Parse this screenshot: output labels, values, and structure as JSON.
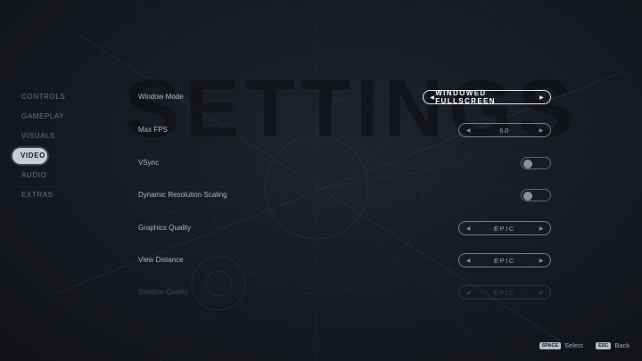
{
  "watermark": "SETTINGS",
  "nav": {
    "items": [
      {
        "label": "CONTROLS",
        "active": false
      },
      {
        "label": "GAMEPLAY",
        "active": false
      },
      {
        "label": "VISUALS",
        "active": false
      },
      {
        "label": "VIDEO",
        "active": true
      },
      {
        "label": "AUDIO",
        "active": false
      },
      {
        "label": "EXTRAS",
        "active": false
      }
    ]
  },
  "settings": {
    "window_mode": {
      "label": "Window Mode",
      "value": "WINDOWED FULLSCREEN"
    },
    "max_fps": {
      "label": "Max FPS",
      "value": "60"
    },
    "vsync": {
      "label": "VSync",
      "on": false
    },
    "dynamic_resolution": {
      "label": "Dynamic Resolution Scaling",
      "on": false
    },
    "graphics_quality": {
      "label": "Graphics Quality",
      "value": "EPIC"
    },
    "view_distance": {
      "label": "View Distance",
      "value": "EPIC"
    },
    "shadow_quality": {
      "label": "Shadow Quality",
      "value": "EPIC"
    }
  },
  "footer": {
    "select_key": "SPACE",
    "select_label": "Select",
    "back_key": "ESC",
    "back_label": "Back"
  },
  "colors": {
    "accent": "#c9cdd6",
    "background": "#181b22"
  }
}
